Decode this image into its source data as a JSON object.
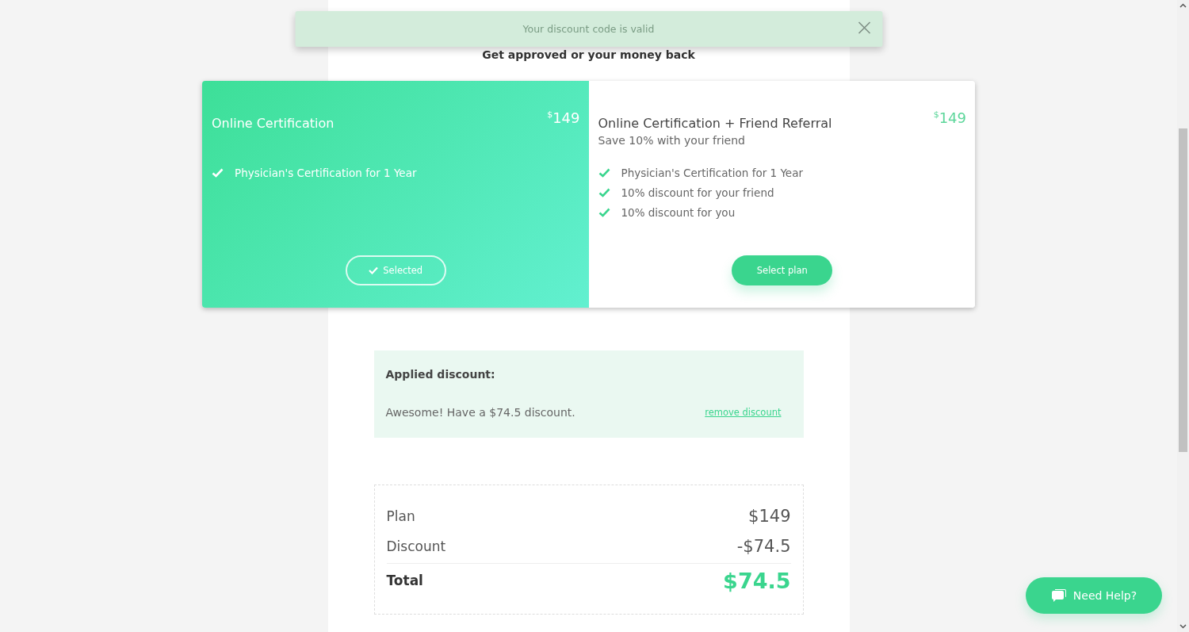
{
  "toast": {
    "message": "Your discount code is valid"
  },
  "heading": "Get approved or your money back",
  "plans": [
    {
      "title": "Online Certification",
      "currency": "$",
      "price": "149",
      "features": [
        "Physician's Certification for 1 Year"
      ],
      "button": "Selected",
      "selected": true
    },
    {
      "title": "Online Certification + Friend Referral",
      "subtitle": "Save 10% with your friend",
      "currency": "$",
      "price": "149",
      "features": [
        "Physician's Certification for 1 Year",
        "10% discount for your friend",
        "10% discount for you"
      ],
      "button": "Select plan",
      "selected": false
    }
  ],
  "discount": {
    "title": "Applied discount:",
    "message": "Awesome! Have a $74.5 discount.",
    "remove_link": "remove discount"
  },
  "summary": {
    "rows": [
      {
        "label": "Plan",
        "value": "$149",
        "kind": "line"
      },
      {
        "label": "Discount",
        "value": "-$74.5",
        "kind": "line"
      },
      {
        "label": "Total",
        "value": "$74.5",
        "kind": "total"
      }
    ]
  },
  "help_button": "Need Help?"
}
